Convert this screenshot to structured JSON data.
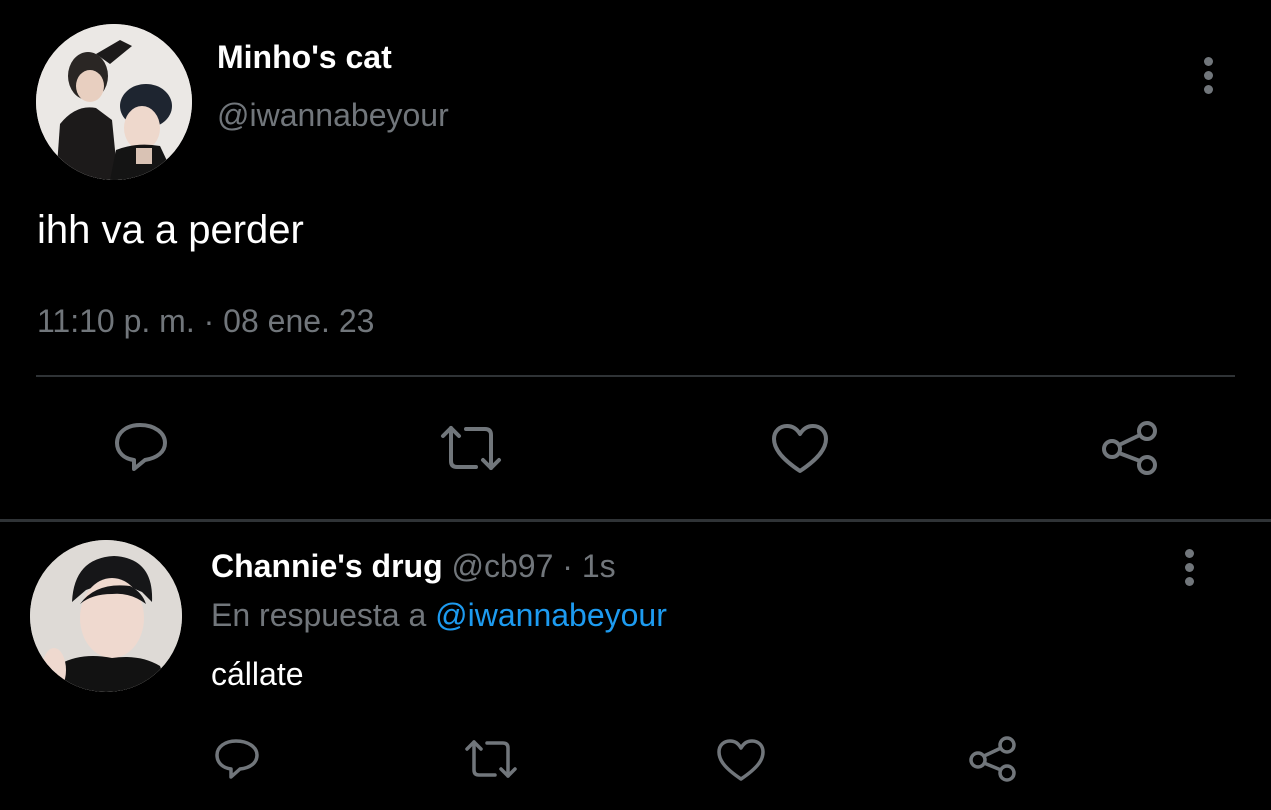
{
  "main_tweet": {
    "author_name": "Minho's cat",
    "author_handle": "@iwannabeyour",
    "text": "ihh va a perder",
    "timestamp": "11:10 p. m. · 08 ene. 23",
    "actions": [
      "reply-icon",
      "retweet-icon",
      "like-icon",
      "share-icon"
    ]
  },
  "reply": {
    "author_name": "Channie's drug",
    "author_handle": "@cb97",
    "separator": "·",
    "time": "1s",
    "reply_to_prefix": "En respuesta a",
    "reply_to_handle": "@iwannabeyour",
    "text": "cállate",
    "actions": [
      "reply-icon",
      "retweet-icon",
      "like-icon",
      "share-icon"
    ]
  },
  "colors": {
    "background": "#000000",
    "text_primary": "#ffffff",
    "text_secondary": "#71767b",
    "link": "#1d9bf0",
    "divider": "#2f3336"
  }
}
